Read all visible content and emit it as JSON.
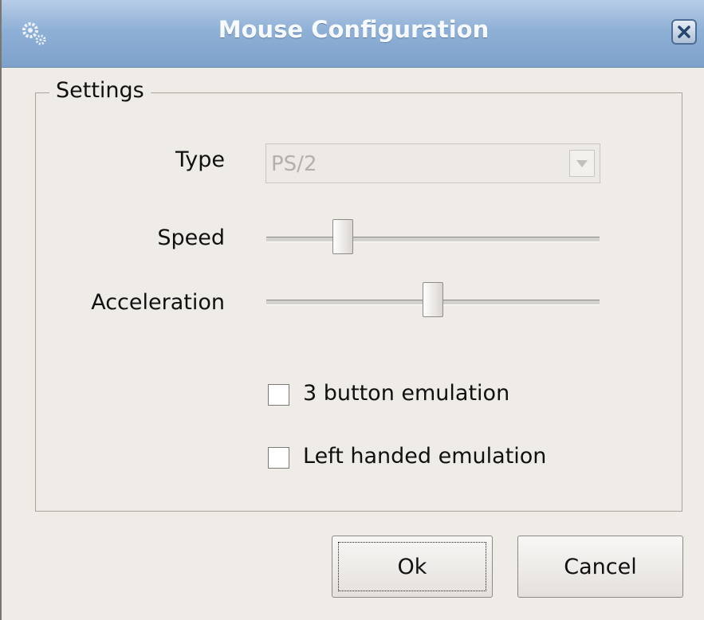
{
  "window": {
    "title": "Mouse Configuration"
  },
  "settings": {
    "group_title": "Settings",
    "type": {
      "label": "Type",
      "value": "PS/2"
    },
    "speed": {
      "label": "Speed",
      "value_fraction": 0.23
    },
    "acceleration": {
      "label": "Acceleration",
      "value_fraction": 0.5
    },
    "three_button": {
      "label": "3 button emulation",
      "checked": false
    },
    "left_handed": {
      "label": "Left handed emulation",
      "checked": false
    }
  },
  "buttons": {
    "ok": "Ok",
    "cancel": "Cancel"
  },
  "icons": {
    "window": "gears-icon",
    "close": "close-icon",
    "dropdown": "chevron-down-icon"
  }
}
